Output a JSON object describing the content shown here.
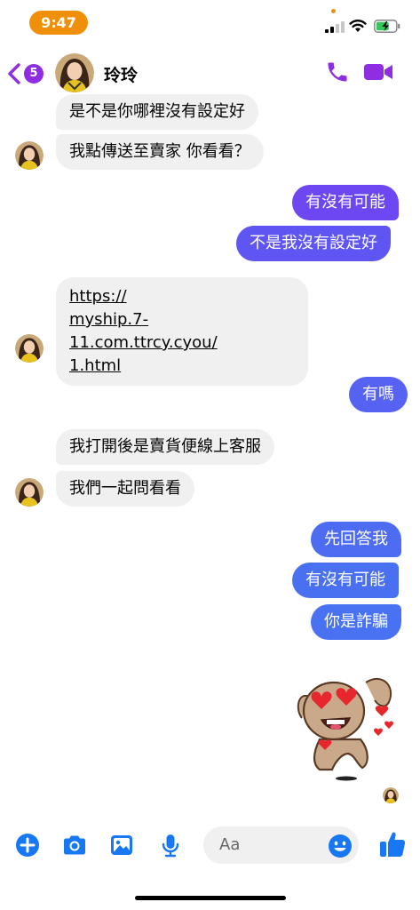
{
  "status_bar": {
    "time": "9:47"
  },
  "header": {
    "unread_count": "5",
    "contact_name": "玲玲"
  },
  "messages": [
    {
      "direction": "incoming",
      "text": "是不是你哪裡沒有設定好"
    },
    {
      "direction": "incoming",
      "text": "我點傳送至賣家 你看看？"
    },
    {
      "direction": "outgoing",
      "text": "有沒有可能"
    },
    {
      "direction": "outgoing",
      "text": "不是我沒有設定好"
    },
    {
      "direction": "incoming",
      "type": "link",
      "lines": [
        "https://",
        "myship.7-11.com.ttrcy.cyou/",
        "1.html"
      ]
    },
    {
      "direction": "outgoing",
      "text": "有嗎"
    },
    {
      "direction": "incoming",
      "text": "我打開後是賣貨便線上客服"
    },
    {
      "direction": "incoming",
      "text": "我們一起問看看"
    },
    {
      "direction": "outgoing",
      "text": "先回答我"
    },
    {
      "direction": "outgoing",
      "text": "有沒有可能"
    },
    {
      "direction": "outgoing",
      "text": "你是詐騙"
    }
  ],
  "sticker": {
    "icon": "heart-eyes-dog-sticker"
  },
  "composer": {
    "placeholder": "Aa",
    "icons": [
      "plus-icon",
      "camera-icon",
      "gallery-icon",
      "microphone-icon",
      "emoji-icon",
      "thumbs-up-icon"
    ]
  },
  "colors": {
    "accent": "#8e2de2",
    "bubble_gradient_top": "#7a3cf0",
    "bubble_gradient_bottom": "#4768f2",
    "composer_blue": "#1877f2",
    "status_orange": "#f0900a",
    "incoming_bubble": "#f0f0f0"
  }
}
